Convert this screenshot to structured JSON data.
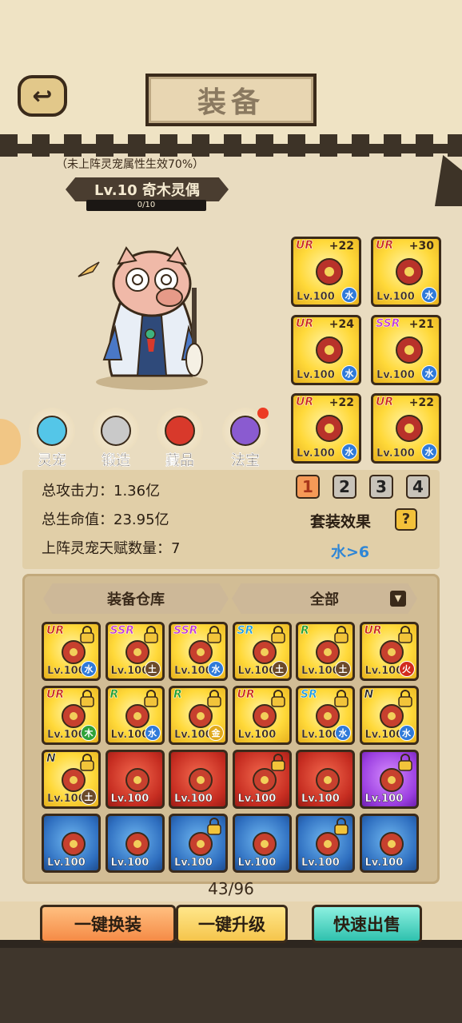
{
  "header": {
    "title": "装备",
    "back_icon": "back-arrow-icon"
  },
  "pet": {
    "hint": "（未上阵灵宠属性生效70%）",
    "level_name": "Lv.10 奇木灵偶",
    "exp": "0/10"
  },
  "equipped": [
    {
      "rarity": "UR",
      "plus": "+22",
      "level": "Lv.100",
      "element": "水",
      "elem_class": "water",
      "icon": "sword-icon"
    },
    {
      "rarity": "UR",
      "plus": "+30",
      "level": "Lv.100",
      "element": "水",
      "elem_class": "water",
      "icon": "armor-icon"
    },
    {
      "rarity": "UR",
      "plus": "+24",
      "level": "Lv.100",
      "element": "水",
      "elem_class": "water",
      "icon": "helmet-icon"
    },
    {
      "rarity": "SSR",
      "plus": "+21",
      "level": "Lv.100",
      "element": "水",
      "elem_class": "water",
      "icon": "boots-icon"
    },
    {
      "rarity": "UR",
      "plus": "+22",
      "level": "Lv.100",
      "element": "水",
      "elem_class": "water",
      "icon": "necklace-icon"
    },
    {
      "rarity": "UR",
      "plus": "+22",
      "level": "Lv.100",
      "element": "水",
      "elem_class": "water",
      "icon": "mask-icon"
    }
  ],
  "categories": [
    {
      "label": "灵宠",
      "icon": "spirit-pet-icon"
    },
    {
      "label": "锻造",
      "icon": "anvil-hammer-icon"
    },
    {
      "label": "藏品",
      "icon": "collection-icon"
    },
    {
      "label": "法宝",
      "icon": "treasure-pouch-icon"
    }
  ],
  "stats": {
    "attack_label": "总攻击力：",
    "attack_value": "1.36亿",
    "hp_label": "总生命值：",
    "hp_value": "23.95亿",
    "talent_label": "上阵灵宠天赋数量：",
    "talent_value": "7",
    "set_tabs": [
      "1",
      "2",
      "3",
      "4"
    ],
    "active_set_tab": 0,
    "set_effect_label": "套装效果",
    "help": "?",
    "set_effect_value": "水>6"
  },
  "warehouse": {
    "tab_label": "装备仓库",
    "filter_label": "全部",
    "items": [
      {
        "rarity": "UR",
        "cls": "ur",
        "bg": "gold",
        "level": "Lv.100",
        "element": "水",
        "elem_class": "water",
        "locked": true
      },
      {
        "rarity": "SSR",
        "cls": "ssr",
        "bg": "gold",
        "level": "Lv.100",
        "element": "土",
        "elem_class": "earth",
        "locked": true
      },
      {
        "rarity": "SSR",
        "cls": "ssr",
        "bg": "gold",
        "level": "Lv.100",
        "element": "水",
        "elem_class": "water",
        "locked": true
      },
      {
        "rarity": "SR",
        "cls": "sr",
        "bg": "gold",
        "level": "Lv.100",
        "element": "土",
        "elem_class": "earth",
        "locked": true
      },
      {
        "rarity": "R",
        "cls": "r",
        "bg": "gold",
        "level": "Lv.100",
        "element": "土",
        "elem_class": "earth",
        "locked": true
      },
      {
        "rarity": "UR",
        "cls": "ur",
        "bg": "gold",
        "level": "Lv.100",
        "element": "火",
        "elem_class": "fire",
        "locked": true
      },
      {
        "rarity": "UR",
        "cls": "ur",
        "bg": "gold",
        "level": "Lv.100",
        "element": "木",
        "elem_class": "wood",
        "locked": true
      },
      {
        "rarity": "R",
        "cls": "r",
        "bg": "gold",
        "level": "Lv.100",
        "element": "水",
        "elem_class": "water",
        "locked": true
      },
      {
        "rarity": "R",
        "cls": "r",
        "bg": "gold",
        "level": "Lv.100",
        "element": "金",
        "elem_class": "metal",
        "locked": true
      },
      {
        "rarity": "UR",
        "cls": "ur",
        "bg": "gold",
        "level": "Lv.100",
        "element": "",
        "elem_class": "",
        "locked": true
      },
      {
        "rarity": "SR",
        "cls": "sr",
        "bg": "gold",
        "level": "Lv.100",
        "element": "水",
        "elem_class": "water",
        "locked": true
      },
      {
        "rarity": "N",
        "cls": "n",
        "bg": "gold",
        "level": "Lv.100",
        "element": "水",
        "elem_class": "water",
        "locked": true
      },
      {
        "rarity": "N",
        "cls": "n",
        "bg": "gold",
        "level": "Lv.100",
        "element": "土",
        "elem_class": "earth",
        "locked": true
      },
      {
        "rarity": "",
        "cls": "",
        "bg": "red",
        "level": "Lv.100",
        "element": "",
        "elem_class": "",
        "locked": false
      },
      {
        "rarity": "",
        "cls": "",
        "bg": "red",
        "level": "Lv.100",
        "element": "",
        "elem_class": "",
        "locked": false
      },
      {
        "rarity": "",
        "cls": "",
        "bg": "red",
        "level": "Lv.100",
        "element": "",
        "elem_class": "",
        "locked": true
      },
      {
        "rarity": "",
        "cls": "",
        "bg": "red",
        "level": "Lv.100",
        "element": "",
        "elem_class": "",
        "locked": false
      },
      {
        "rarity": "",
        "cls": "",
        "bg": "purple",
        "level": "Lv.100",
        "element": "",
        "elem_class": "",
        "locked": true
      },
      {
        "rarity": "",
        "cls": "",
        "bg": "blue",
        "level": "Lv.100",
        "element": "",
        "elem_class": "",
        "locked": false
      },
      {
        "rarity": "",
        "cls": "",
        "bg": "blue",
        "level": "Lv.100",
        "element": "",
        "elem_class": "",
        "locked": false
      },
      {
        "rarity": "",
        "cls": "",
        "bg": "blue",
        "level": "Lv.100",
        "element": "",
        "elem_class": "",
        "locked": true
      },
      {
        "rarity": "",
        "cls": "",
        "bg": "blue",
        "level": "Lv.100",
        "element": "",
        "elem_class": "",
        "locked": false
      },
      {
        "rarity": "",
        "cls": "",
        "bg": "blue",
        "level": "Lv.100",
        "element": "",
        "elem_class": "",
        "locked": true
      },
      {
        "rarity": "",
        "cls": "",
        "bg": "blue",
        "level": "Lv.100",
        "element": "",
        "elem_class": "",
        "locked": false
      }
    ],
    "page": "43/96"
  },
  "actions": {
    "auto_equip": "一键换装",
    "auto_upgrade": "一键升级",
    "quick_sell": "快速出售"
  }
}
